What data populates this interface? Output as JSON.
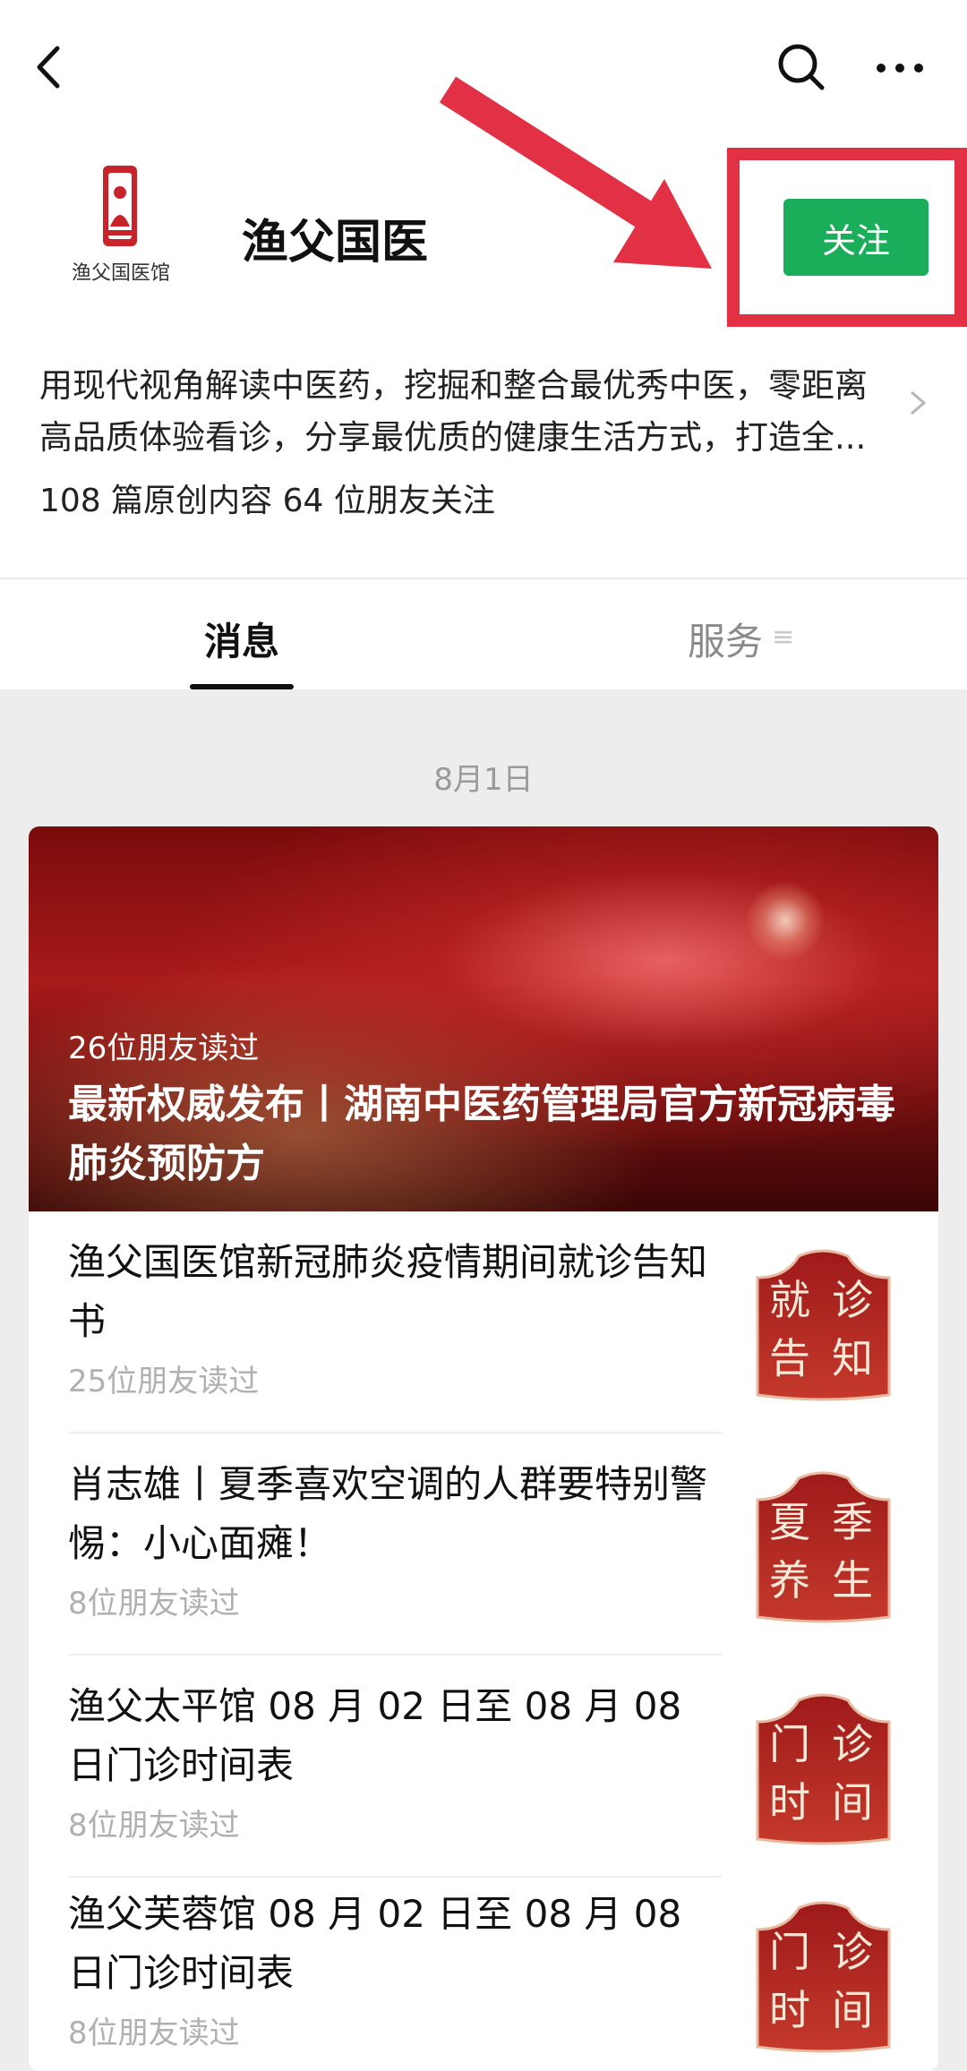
{
  "header": {
    "account_name": "渔父国医",
    "logo_caption": "渔父国医馆",
    "follow_label": "关注",
    "description": "用现代视角解读中医药，挖掘和整合最优秀中医，零距离高品质体验看诊，分享最优质的健康生活方式，打造全...",
    "stats": "108 篇原创内容  64 位朋友关注",
    "highlight_color": "#e23045",
    "follow_color": "#1aad5a"
  },
  "tabs": {
    "messages": "消息",
    "services": "服务",
    "services_icon": "≡"
  },
  "feed": {
    "date": "8月1日",
    "banner": {
      "read_by": "26位朋友读过",
      "title": "最新权威发布丨湖南中医药管理局官方新冠病毒肺炎预防方"
    },
    "articles": [
      {
        "title": "渔父国医馆新冠肺炎疫情期间就诊告知书",
        "read_by": "25位朋友读过",
        "thumb_chars": [
          "就",
          "诊",
          "告",
          "知"
        ]
      },
      {
        "title": "肖志雄丨夏季喜欢空调的人群要特别警惕：小心面瘫！",
        "read_by": "8位朋友读过",
        "thumb_chars": [
          "夏",
          "季",
          "养",
          "生"
        ]
      },
      {
        "title": "渔父太平馆 08 月 02 日至 08 月 08 日门诊时间表",
        "read_by": "8位朋友读过",
        "thumb_chars": [
          "门",
          "诊",
          "时",
          "间"
        ]
      },
      {
        "title": "渔父芙蓉馆 08 月 02 日至 08 月 08 日门诊时间表",
        "read_by": "8位朋友读过",
        "thumb_chars": [
          "门",
          "诊",
          "时",
          "间"
        ]
      }
    ]
  }
}
